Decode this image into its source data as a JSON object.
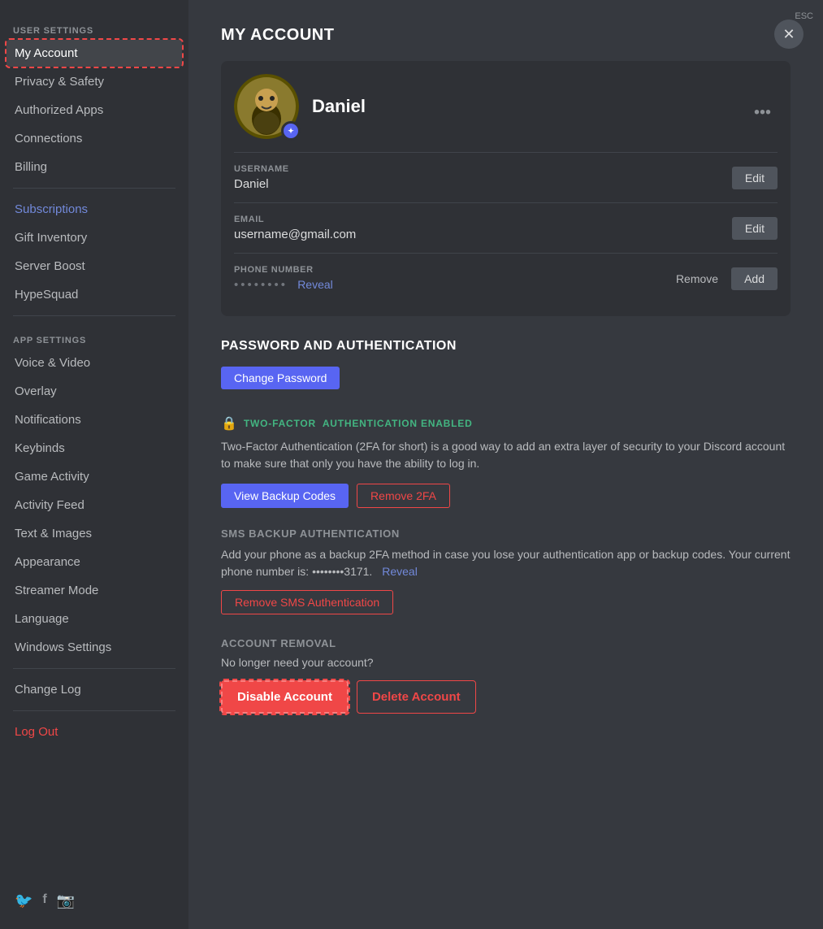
{
  "sidebar": {
    "user_settings_label": "USER SETTINGS",
    "app_settings_label": "APP SETTINGS",
    "items_user": [
      {
        "id": "my-account",
        "label": "My Account",
        "active": true
      },
      {
        "id": "privacy-safety",
        "label": "Privacy & Safety"
      },
      {
        "id": "authorized-apps",
        "label": "Authorized Apps"
      },
      {
        "id": "connections",
        "label": "Connections"
      },
      {
        "id": "billing",
        "label": "Billing"
      }
    ],
    "items_nitro": [
      {
        "id": "subscriptions",
        "label": "Subscriptions",
        "blue": true
      },
      {
        "id": "gift-inventory",
        "label": "Gift Inventory"
      },
      {
        "id": "server-boost",
        "label": "Server Boost"
      },
      {
        "id": "hypesquad",
        "label": "HypeSquad"
      }
    ],
    "items_app": [
      {
        "id": "voice-video",
        "label": "Voice & Video"
      },
      {
        "id": "overlay",
        "label": "Overlay"
      },
      {
        "id": "notifications",
        "label": "Notifications"
      },
      {
        "id": "keybinds",
        "label": "Keybinds"
      },
      {
        "id": "game-activity",
        "label": "Game Activity"
      },
      {
        "id": "activity-feed",
        "label": "Activity Feed"
      },
      {
        "id": "text-images",
        "label": "Text & Images"
      },
      {
        "id": "appearance",
        "label": "Appearance"
      },
      {
        "id": "streamer-mode",
        "label": "Streamer Mode"
      },
      {
        "id": "language",
        "label": "Language"
      },
      {
        "id": "windows-settings",
        "label": "Windows Settings"
      }
    ],
    "items_bottom": [
      {
        "id": "change-log",
        "label": "Change Log"
      }
    ],
    "logout_label": "Log Out",
    "social": [
      "🐦",
      "f",
      "📷"
    ]
  },
  "main": {
    "page_title": "MY ACCOUNT",
    "profile": {
      "name": "Daniel",
      "username_label": "USERNAME",
      "username_value": "Daniel",
      "email_label": "EMAIL",
      "email_value": "username@gmail.com",
      "phone_label": "PHONE NUMBER",
      "phone_masked": "••••••••",
      "phone_reveal": "Reveal",
      "edit_label": "Edit",
      "remove_label": "Remove",
      "add_label": "Add",
      "menu_dots": "•••"
    },
    "password_section": {
      "title": "PASSWORD AND AUTHENTICATION",
      "change_password_label": "Change Password",
      "twofa_status": "🔒 TWO-FACTOR  AUTHENTICATION ENABLED",
      "twofa_description": "Two-Factor Authentication (2FA for short) is a good way to add an extra layer of security to your Discord account to make sure that only you have the ability to log in.",
      "view_backup_label": "View Backup Codes",
      "remove_2fa_label": "Remove 2FA",
      "sms_title": "SMS BACKUP AUTHENTICATION",
      "sms_description": "Add your phone as a backup 2FA method in case you lose your authentication app or backup codes. Your current phone number is: ••••••••3171.",
      "sms_reveal": "Reveal",
      "remove_sms_label": "Remove SMS Authentication"
    },
    "account_removal": {
      "title": "ACCOUNT REMOVAL",
      "description": "No longer need your account?",
      "disable_label": "Disable Account",
      "delete_label": "Delete Account"
    },
    "close_label": "ESC"
  }
}
